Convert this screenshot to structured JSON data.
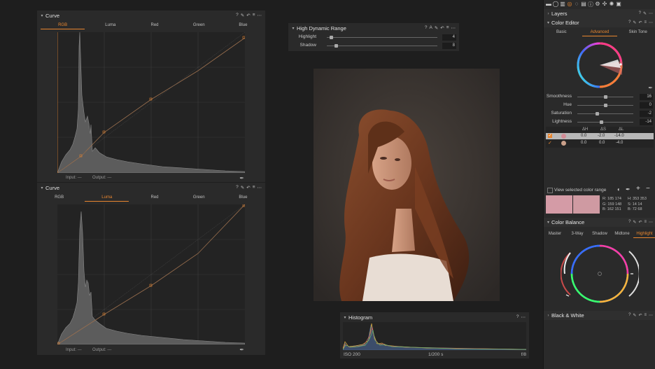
{
  "curve_top": {
    "title": "Curve",
    "tabs": [
      "RGB",
      "Luma",
      "Red",
      "Green",
      "Blue"
    ],
    "active_tab": "RGB",
    "input_label": "Input:",
    "input_value": "---",
    "output_label": "Output:",
    "output_value": "---",
    "tool_icons": [
      "help-icon",
      "pin-icon",
      "reset-icon",
      "copy-apply-icon",
      "more-icon"
    ]
  },
  "curve_bottom": {
    "title": "Curve",
    "tabs": [
      "RGB",
      "Luma",
      "Red",
      "Green",
      "Blue"
    ],
    "active_tab": "Luma",
    "input_label": "Input:",
    "input_value": "---",
    "output_label": "Output:",
    "output_value": "---"
  },
  "hdr": {
    "title": "High Dynamic Range",
    "auto_label": "A",
    "sliders": [
      {
        "label": "Highlight",
        "value": "4",
        "level": 0.04
      },
      {
        "label": "Shadow",
        "value": "8",
        "level": 0.08
      }
    ]
  },
  "histogram": {
    "title": "Histogram",
    "iso": "ISO 200",
    "shutter": "1/200 s",
    "aperture": "f/8"
  },
  "toolbar_icons": [
    "folder-icon",
    "capture-icon",
    "library-icon",
    "color-icon",
    "lens-icon",
    "details-icon",
    "metadata-icon",
    "adjustments-icon",
    "output-icon",
    "batch-icon",
    "camera-icon"
  ],
  "layers": {
    "title": "Layers"
  },
  "color_editor": {
    "title": "Color Editor",
    "tabs": [
      "Basic",
      "Advanced",
      "Skin Tone"
    ],
    "active_tab": "Advanced",
    "sliders": [
      {
        "label": "Smoothness",
        "value": "16",
        "level": 0.5
      },
      {
        "label": "Hue",
        "value": "0",
        "level": 0.5
      },
      {
        "label": "Saturation",
        "value": "-2",
        "level": 0.35
      },
      {
        "label": "Lightness",
        "value": "-14",
        "level": 0.43
      }
    ],
    "table_headers": [
      "ΔH",
      "ΔS",
      "ΔL"
    ],
    "rows": [
      {
        "checked": true,
        "swatch": "#d38c96",
        "dh": "0.0",
        "ds": "-2.0",
        "dl": "-14.0",
        "selected": true
      },
      {
        "checked": true,
        "swatch": "#caa08a",
        "dh": "0.0",
        "ds": "0.0",
        "dl": "-4.0",
        "selected": false
      }
    ],
    "view_range_label": "View selected color range",
    "swatch_left": "#d49ba6",
    "swatch_right": "#cf9aa2",
    "readout": {
      "r": [
        "R:",
        "185",
        "174"
      ],
      "g": [
        "G:",
        "159",
        "148"
      ],
      "b": [
        "B:",
        "162",
        "151"
      ],
      "h": [
        "H:",
        "353",
        "353"
      ],
      "s": [
        "S:",
        "14",
        "14"
      ],
      "bb": [
        "B:",
        "72",
        "68"
      ]
    }
  },
  "color_balance": {
    "title": "Color Balance",
    "tabs": [
      "Master",
      "3-Way",
      "Shadow",
      "Midtone",
      "Highlight"
    ],
    "active_tab": "Highlight"
  },
  "black_white": {
    "title": "Black & White"
  },
  "colors": {
    "accent": "#e8862f",
    "panel": "#2a2a2a",
    "background": "#1e1e1e"
  }
}
